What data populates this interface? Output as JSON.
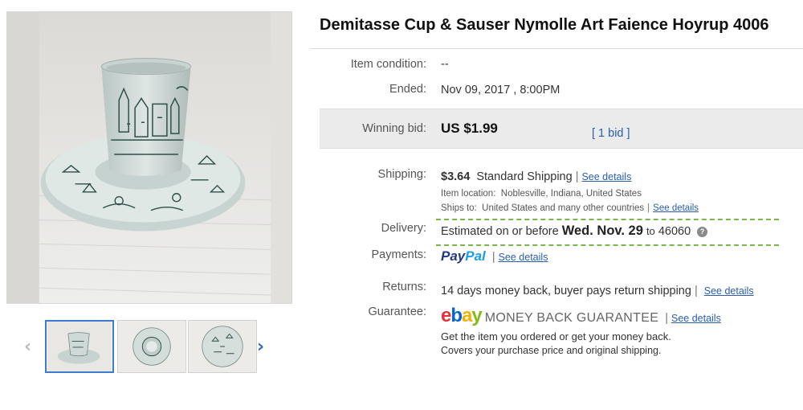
{
  "listing": {
    "title": "Demitasse Cup & Sauser Nymolle Art Faience Hoyrup 4006"
  },
  "details": {
    "condition_label": "Item condition:",
    "condition_value": "--",
    "ended_label": "Ended:",
    "ended_value": "Nov 09, 2017 , 8:00PM",
    "winning_bid_label": "Winning bid:",
    "winning_bid_value": "US $1.99",
    "bid_count": "[ 1 bid ]",
    "shipping_label": "Shipping:",
    "shipping_cost": "$3.64",
    "shipping_method": "Standard Shipping",
    "see_details": "See details",
    "item_location_label": "Item location:",
    "item_location_value": "Noblesville, Indiana, United States",
    "ships_to_label": "Ships to:",
    "ships_to_value": "United States and many other countries",
    "delivery_label": "Delivery:",
    "delivery_prefix": "Estimated on or before",
    "delivery_date": "Wed. Nov. 29",
    "delivery_to": "to",
    "delivery_zip": "46060",
    "payments_label": "Payments:",
    "paypal_part1": "Pay",
    "paypal_part2": "Pal",
    "returns_label": "Returns:",
    "returns_value": "14 days money back, buyer pays return shipping",
    "guarantee_label": "Guarantee:",
    "ebay_letters": [
      "e",
      "b",
      "a",
      "y"
    ],
    "mbg_text": "MONEY BACK GUARANTEE",
    "guarantee_line1": "Get the item you ordered or get your money back.",
    "guarantee_line2": "Covers your purchase price and original shipping."
  },
  "gallery": {
    "thumbnails": [
      "cup and saucer side view",
      "cup on saucer top view",
      "saucer top view"
    ],
    "active_index": 0
  },
  "colors": {
    "link": "#2a5db0",
    "delivery_border": "#7ab648",
    "bid_panel": "#ebebeb",
    "ebay": [
      "#e53238",
      "#0064d2",
      "#f5af02",
      "#86b817"
    ],
    "paypal": [
      "#233b7e",
      "#1a9fe0"
    ]
  }
}
